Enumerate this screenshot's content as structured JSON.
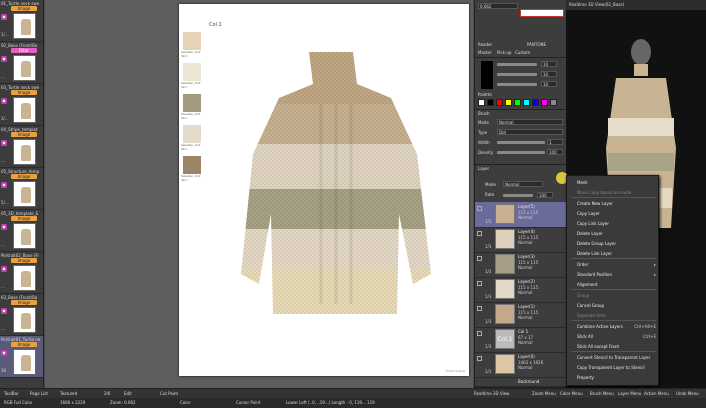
{
  "left_strip": {
    "items": [
      {
        "name": "01_Turtle neck swe",
        "badge": "Image",
        "num": "1/..."
      },
      {
        "name": "02_Base (Front/Ba",
        "badge": "Filter",
        "num": "..."
      },
      {
        "name": "03_Turtle neck swe",
        "badge": "Image",
        "num": "3/..."
      },
      {
        "name": "04_Stripe_templat",
        "badge": "Image",
        "num": "..."
      },
      {
        "name": "05_Structure_temp",
        "badge": "Image",
        "num": "5/..."
      },
      {
        "name": "05_3D_template_E",
        "badge": "Image",
        "num": "..."
      },
      {
        "name": "Portrait02_Base (Fr",
        "badge": "Image",
        "num": "..."
      },
      {
        "name": "03_Base (Front/Ba",
        "badge": "Image",
        "num": "..."
      },
      {
        "name": "Portrait01_Turtle ne",
        "badge": "Image",
        "num": "38"
      }
    ]
  },
  "canvas": {
    "title": "Col.1",
    "swatches": [
      {
        "label": "Sweater_knit Yarn",
        "color": "#e6d2b4"
      },
      {
        "label": "Sweater_knit Yarn",
        "color": "#ece4d4"
      },
      {
        "label": "Sweater_knit Yarn",
        "color": "#a49a80"
      },
      {
        "label": "Sweater_knit Yarn",
        "color": "#e4dacb"
      },
      {
        "label": "Sweater_knit Yarn",
        "color": "#9c8468"
      }
    ],
    "footer": "©CLO Virtual"
  },
  "right_panel": {
    "color_tab": "Reader",
    "color_mode": "PANTONE",
    "color_subtabs": [
      "Master",
      "Pick-up",
      "Custom"
    ],
    "rgb_rows": [
      "10",
      "10",
      "10"
    ],
    "palette_label": "Palette",
    "palette_colors": [
      "#ffffff",
      "#000000",
      "#ff0000",
      "#ffff00",
      "#00ff00",
      "#00ffff",
      "#0000ff",
      "#ff00ff",
      "#888888"
    ],
    "brush": {
      "title": "Brush",
      "mode_label": "Mode",
      "mode_value": "Normal",
      "type_label": "Type",
      "type_value": "Dot",
      "width_label": "Width",
      "width_value": "1",
      "density_label": "Density",
      "density_value": "100"
    },
    "layer": {
      "title": "Layer",
      "mode_label": "Mode",
      "mode_value": "Normal",
      "rate_label": "Rate",
      "rate_value": "100",
      "rows": [
        {
          "name": "Layer(5)",
          "size": "115 x 115",
          "mode": "Normal",
          "pct": "1/3",
          "color": "#c8b090",
          "selected": true
        },
        {
          "name": "Layer(4)",
          "size": "115 x 115",
          "mode": "Normal",
          "pct": "1/3",
          "color": "#ddd0bc",
          "selected": false
        },
        {
          "name": "Layer(3)",
          "size": "115 x 115",
          "mode": "Normal",
          "pct": "1/3",
          "color": "#a69e86",
          "selected": false
        },
        {
          "name": "Layer(2)",
          "size": "115 x 115",
          "mode": "Normal",
          "pct": "1/3",
          "color": "#e2d8c6",
          "selected": false
        },
        {
          "name": "Layer(1)",
          "size": "115 x 115",
          "mode": "Normal",
          "pct": "1/3",
          "color": "#c4a88a",
          "selected": false
        },
        {
          "name": "Col 1",
          "size": "67 x 17",
          "mode": "Normal",
          "pct": "1/3",
          "color": "#bbbbbb",
          "selected": false,
          "text": "Col.1"
        },
        {
          "name": "Layer(0)",
          "size": "1463 x 1926",
          "mode": "Normal",
          "pct": "1/3",
          "color": "#dcc6a6",
          "selected": false
        }
      ],
      "bottom_row": "Backround"
    }
  },
  "view3d": {
    "title": "Realtime 3D View(02_Base)"
  },
  "context_menu": {
    "items": [
      {
        "label": "Mesh",
        "shortcut": "",
        "disabled": false
      },
      {
        "label": "Move Copy based on mode",
        "shortcut": "",
        "disabled": true
      },
      {
        "label": "Create New Layer",
        "shortcut": "",
        "disabled": false
      },
      {
        "label": "Copy Layer",
        "shortcut": "",
        "disabled": false
      },
      {
        "label": "Copy Link Layer",
        "shortcut": "",
        "disabled": false
      },
      {
        "label": "Delete Layer",
        "shortcut": "",
        "disabled": false
      },
      {
        "label": "Delete Group Layer",
        "shortcut": "",
        "disabled": false
      },
      {
        "label": "Delete Link Layer",
        "shortcut": "",
        "disabled": false
      },
      {
        "label": "Order",
        "shortcut": "▸",
        "disabled": false
      },
      {
        "label": "Standard Position",
        "shortcut": "▸",
        "disabled": false
      },
      {
        "label": "Alignment",
        "shortcut": "",
        "disabled": false
      },
      {
        "label": "Group",
        "shortcut": "",
        "disabled": true
      },
      {
        "label": "Cancel Group",
        "shortcut": "",
        "disabled": false
      },
      {
        "label": "Separate Item",
        "shortcut": "",
        "disabled": true
      },
      {
        "label": "Combine Active Layers",
        "shortcut": "Ctrl+Alt+E",
        "disabled": false
      },
      {
        "label": "Stick All",
        "shortcut": "Ctrl+E",
        "disabled": false
      },
      {
        "label": "Stick All except Front",
        "shortcut": "",
        "disabled": false
      },
      {
        "label": "Convert Stencil to Transparent Layer",
        "shortcut": "",
        "disabled": false
      },
      {
        "label": "Copy Transparent Layer to Stencil",
        "shortcut": "",
        "disabled": false
      },
      {
        "label": "Property",
        "shortcut": "",
        "disabled": false
      }
    ]
  },
  "bottom_toolbar": {
    "items": [
      "ToolBar",
      "Page List",
      "Textured",
      "2/6",
      "Edit",
      "Cut Paint",
      "Realtime 3D View",
      "Zoom Menu",
      "Color Menu",
      "Brush Menu",
      "Layer Menu",
      "Action Menu",
      "Undo Menu"
    ]
  },
  "status_bar": {
    "items": [
      "RGB Full Color",
      "1666 x 2229",
      "Zoom: 0.662",
      "Color",
      "Cursor Point",
      "Lower Left (..0, ..19...) Length : 0, 119... 119"
    ]
  }
}
